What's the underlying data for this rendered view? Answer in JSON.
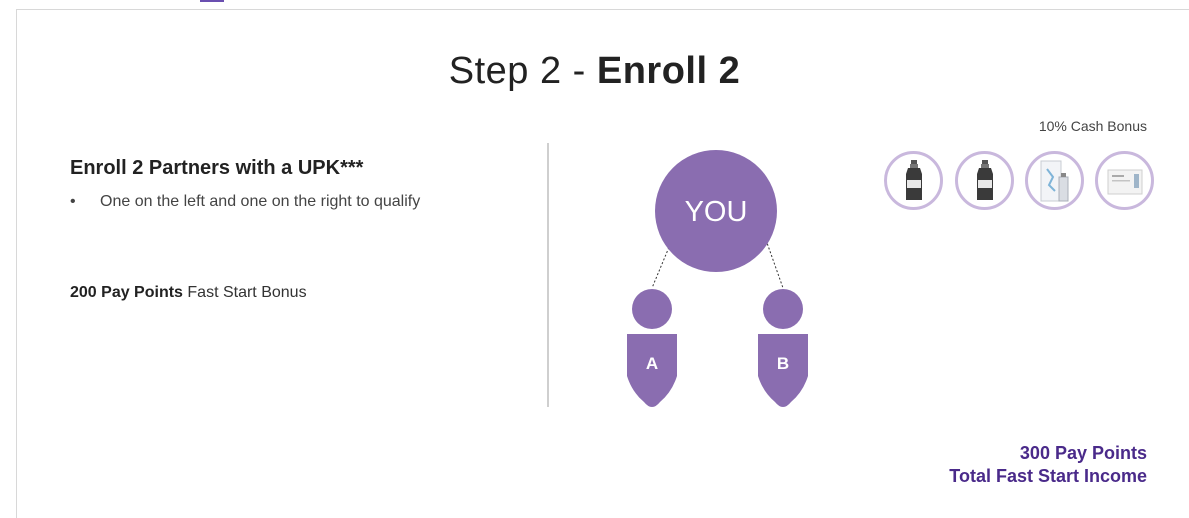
{
  "title": {
    "prefix": "Step 2 - ",
    "emphasis": "Enroll 2"
  },
  "left": {
    "heading": "Enroll 2 Partners with a UPK***",
    "bullet": "One on the left and one on the right to qualify",
    "paypoints_bold": "200 Pay Points",
    "paypoints_rest": " Fast Start Bonus"
  },
  "diagram": {
    "you_label": "YOU",
    "left_label": "A",
    "right_label": "B",
    "color": "#8a6db0"
  },
  "cash_bonus": {
    "label": "10% Cash Bonus",
    "products": [
      "bottle",
      "bottle",
      "tube-box",
      "box"
    ]
  },
  "total": {
    "line1": "300 Pay Points",
    "line2": "Total Fast Start Income"
  }
}
